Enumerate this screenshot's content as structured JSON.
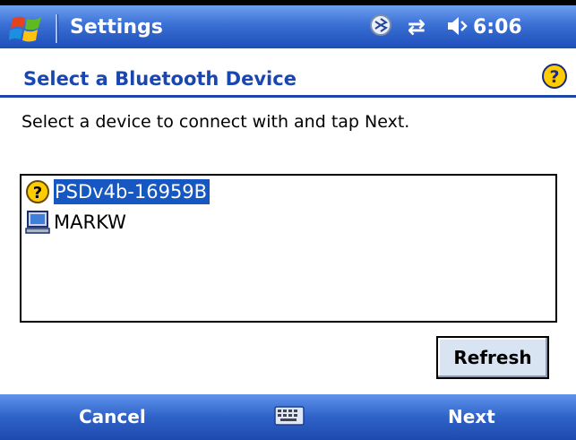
{
  "titlebar": {
    "title": "Settings",
    "start_icon": "windows-flag-icon",
    "status_icons": [
      "sync-icon",
      "connectivity-icon",
      "volume-icon"
    ],
    "time": "6:06"
  },
  "header": {
    "title": "Select a Bluetooth Device",
    "help_icon": "help-icon"
  },
  "instructions": "Select a device to connect with and tap Next.",
  "devices": [
    {
      "label": "PSDv4b-16959B",
      "icon": "unknown-device-icon",
      "selected": true
    },
    {
      "label": "MARKW",
      "icon": "computer-icon",
      "selected": false
    }
  ],
  "refresh_label": "Refresh",
  "menubar": {
    "left_softkey": "Cancel",
    "keyboard_icon": "keyboard-icon",
    "right_softkey": "Next"
  },
  "colors": {
    "bar_blue": "#2f62c8",
    "header_text": "#1a46b0",
    "selection": "#1757c2",
    "button_face": "#d9e4f2"
  }
}
